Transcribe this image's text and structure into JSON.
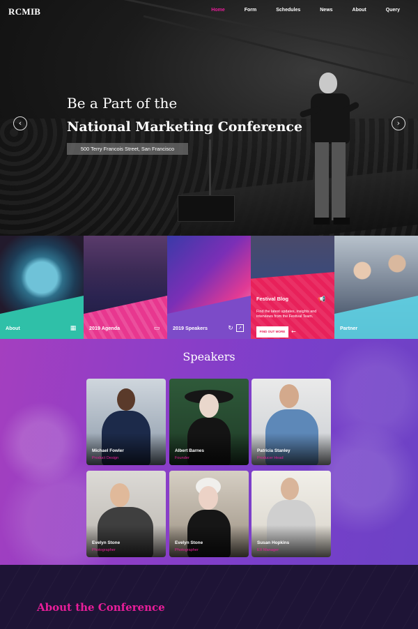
{
  "nav": {
    "logo": "RCMIB",
    "items": [
      {
        "label": "Home",
        "active": true
      },
      {
        "label": "Form"
      },
      {
        "label": "Schedules"
      },
      {
        "label": "News"
      },
      {
        "label": "About"
      },
      {
        "label": "Query"
      }
    ]
  },
  "hero": {
    "line1": "Be a Part of the",
    "line2": "National Marketing Conference",
    "address": "500 Terry Francois Street, San Francisco",
    "prev_icon": "chevron-left-icon",
    "next_icon": "chevron-right-icon"
  },
  "tiles": [
    {
      "label": "About",
      "icon": "calendar-icon",
      "color": "#2fc0a8"
    },
    {
      "label": "2019 Agenda",
      "icon": "ticket-icon",
      "color": "#e8378f"
    },
    {
      "label": "2019 Speakers",
      "icon": "share-icon",
      "color": "#7c4bc8"
    },
    {
      "label": "Festival Blog",
      "icon": "megaphone-icon",
      "color": "#e8215a",
      "text": "Find the latest updates, insights and interviews from the Festival Team.",
      "button": "FIND OUT MORE"
    },
    {
      "label": "Partner",
      "icon": "",
      "color": "#5ed3e6"
    }
  ],
  "speakers": {
    "title": "Speakers",
    "people": [
      {
        "name": "Michael Fowler",
        "role": "Product Design"
      },
      {
        "name": "Albert Barnes",
        "role": "Founder"
      },
      {
        "name": "Patricia Stanley",
        "role": "Producer Head"
      },
      {
        "name": "Evelyn Stone",
        "role": "Photographer"
      },
      {
        "name": "Evelyn Stone",
        "role": "Photographer"
      },
      {
        "name": "Susan Hopkins",
        "role": "EX Manager"
      }
    ]
  },
  "about": {
    "title": "About the Conference"
  },
  "colors": {
    "accent": "#e91e9a",
    "purple": "#7a3fca",
    "dark": "#1e1436"
  }
}
